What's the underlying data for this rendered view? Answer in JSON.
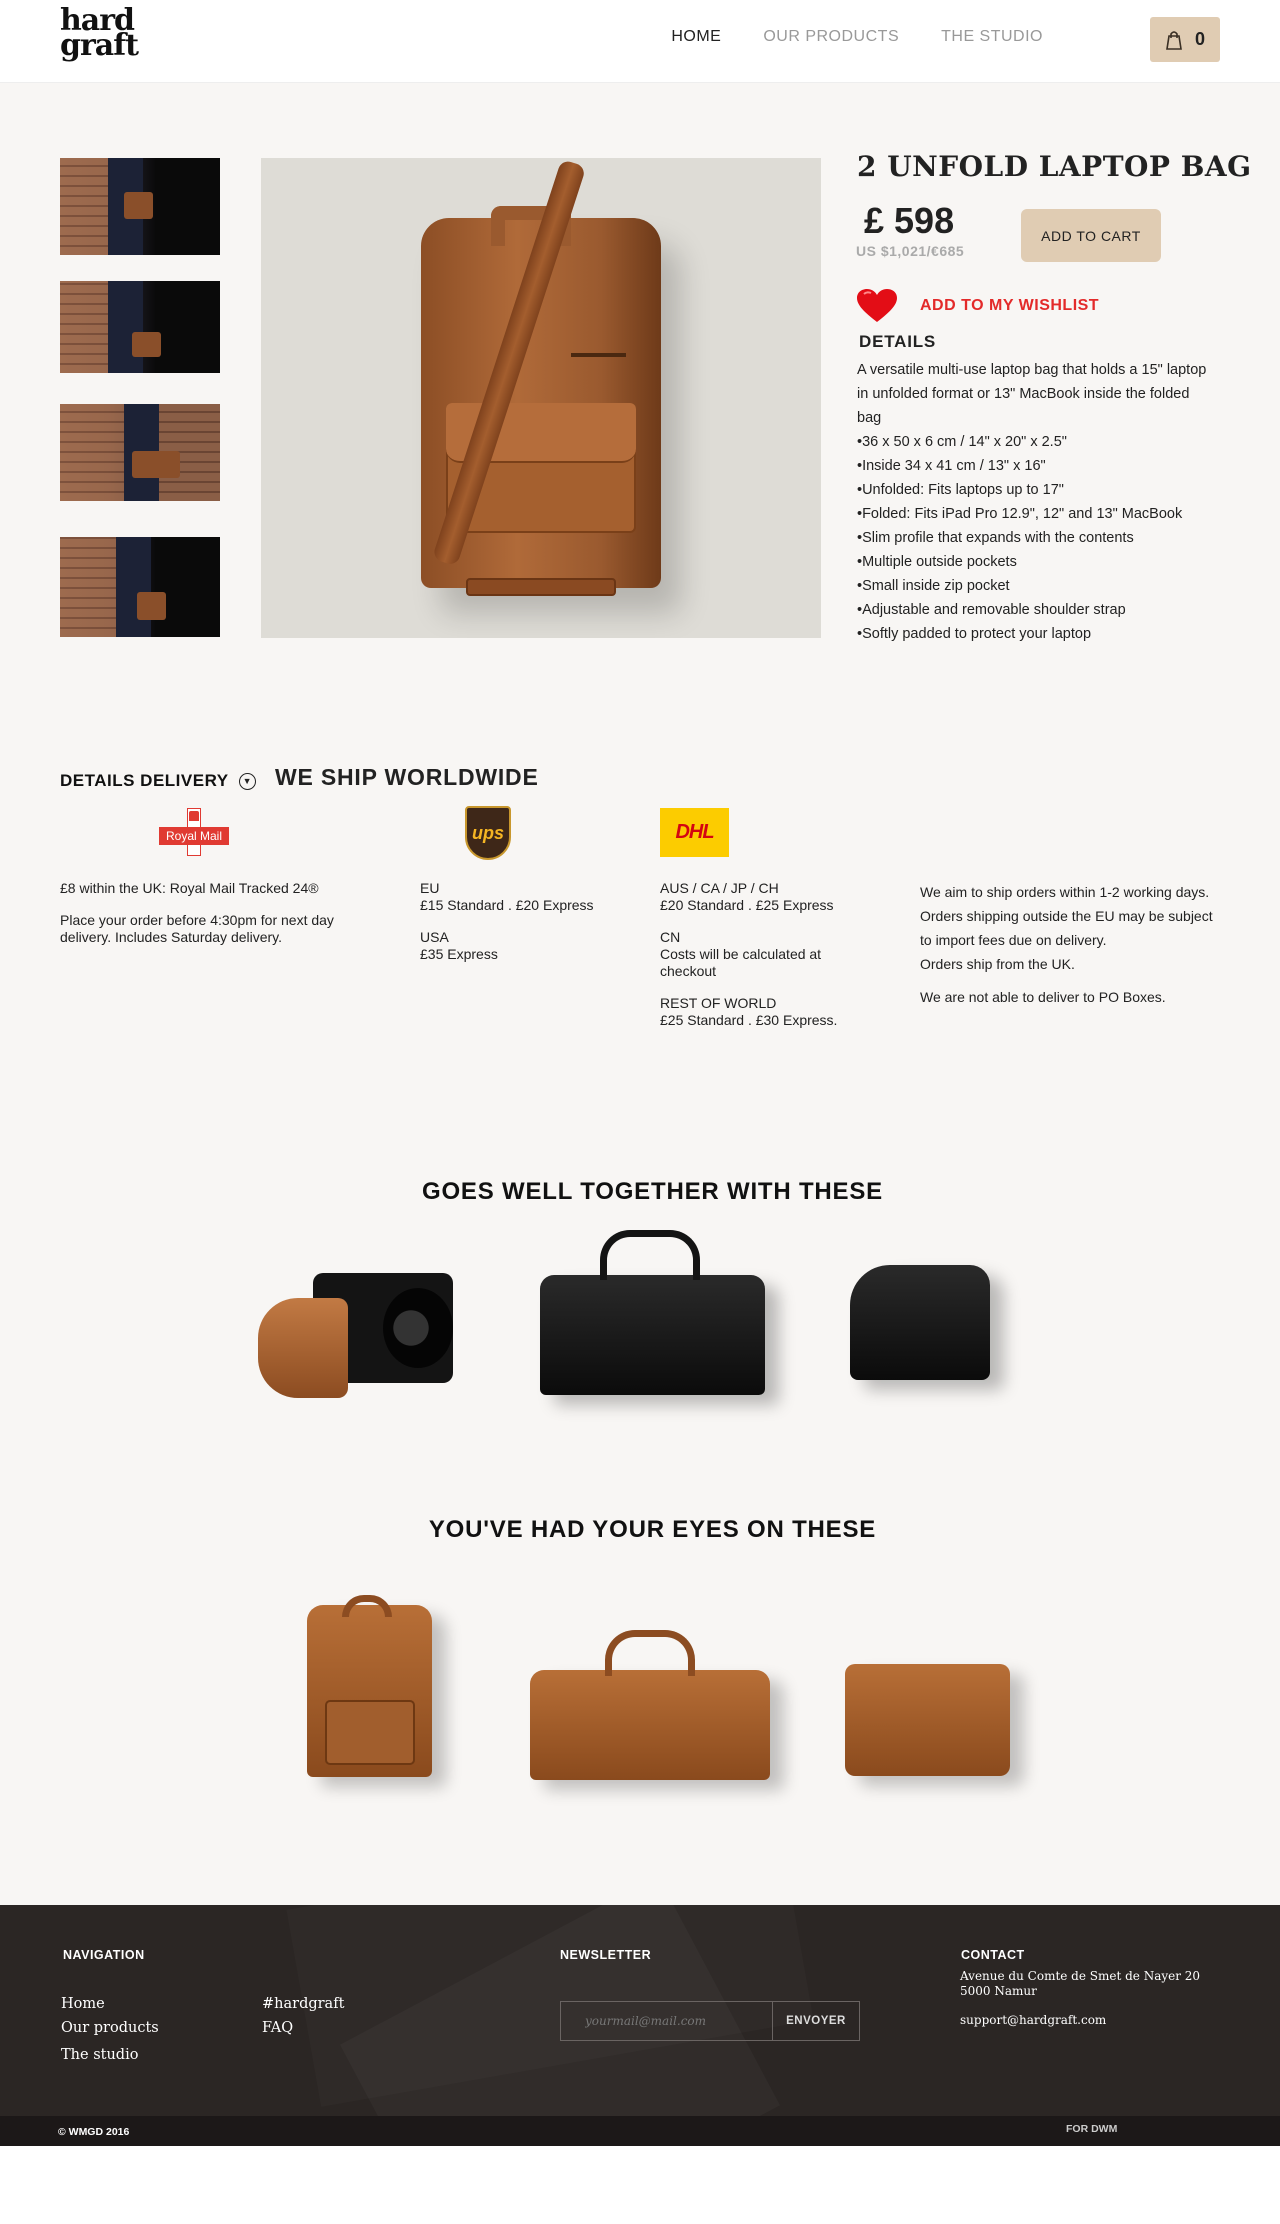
{
  "header": {
    "logo_line1": "hard",
    "logo_line2": "graft",
    "nav": [
      {
        "label": "HOME",
        "active": true
      },
      {
        "label": "OUR PRODUCTS",
        "active": false
      },
      {
        "label": "THE STUDIO",
        "active": false
      }
    ],
    "cart_count": "0",
    "cart_icon": "shopping-bag-icon"
  },
  "product": {
    "title": "2 UNFOLD LAPTOP BAG",
    "price": "£ 598",
    "price_alt": "US $1,021/€685",
    "add_to_cart": "ADD TO CART",
    "wishlist": "ADD TO MY WISHLIST",
    "wishlist_icon": "heart-icon",
    "details_heading": "DETAILS",
    "details_intro": "A versatile multi-use laptop bag that holds a 15\" laptop in unfolded format or 13\" MacBook inside the folded bag",
    "details_list": [
      "36 x 50 x 6 cm / 14\" x 20\" x 2.5\"",
      "Inside 34 x 41 cm / 13\" x 16\"",
      "Unfolded: Fits laptops up to 17\"",
      "Folded: Fits iPad Pro 12.9\", 12\" and 13\" MacBook",
      "Slim profile that expands with the contents",
      "Multiple outside pockets",
      "Small inside zip pocket",
      "Adjustable and removable shoulder strap",
      "Softly padded to protect your laptop"
    ]
  },
  "delivery": {
    "label": "DETAILS DELIVERY",
    "headline": "WE SHIP WORLDWIDE",
    "royalmail_logo": "Royal Mail",
    "ups_logo": "ups",
    "dhl_logo": "DHL",
    "uk": {
      "line1": "£8 within the UK: Royal Mail Tracked 24®",
      "line2": "Place your order before 4:30pm for next day delivery. Includes Saturday delivery."
    },
    "ups_col": {
      "eu_title": "EU",
      "eu_rates": "£15 Standard . £20 Express",
      "usa_title": "USA",
      "usa_rates": "£35 Express"
    },
    "dhl_col": {
      "aus_title": "AUS / CA / JP / CH",
      "aus_rates": "£20 Standard . £25 Express",
      "cn_title": "CN",
      "cn_rates": "Costs will be calculated at checkout",
      "row_title": "REST OF WORLD",
      "row_rates": "£25 Standard . £30 Express."
    },
    "notes": {
      "line1": "We aim to ship orders within 1-2 working days.",
      "line2": "Orders shipping outside the EU may be subject to import fees due on delivery.",
      "line3": "Orders ship from the UK.",
      "line4": "We are not able to deliver to PO Boxes."
    }
  },
  "related": {
    "title": "GOES WELL TOGETHER WITH THESE"
  },
  "viewed": {
    "title": "YOU'VE HAD YOUR EYES ON THESE"
  },
  "footer": {
    "nav_heading": "NAVIGATION",
    "nav_links": [
      "Home",
      "Our products",
      "The studio"
    ],
    "extra_links": [
      "#hardgraft",
      "FAQ"
    ],
    "newsletter_heading": "NEWSLETTER",
    "newsletter_placeholder": "yourmail@mail.com",
    "newsletter_button": "ENVOYER",
    "contact_heading": "CONTACT",
    "contact_address1": "Avenue du Comte de Smet de Nayer 20",
    "contact_address2": "5000 Namur",
    "contact_email": "support@hardgraft.com",
    "copyright": "© WMGD 2016",
    "credit": "FOR DWM"
  }
}
